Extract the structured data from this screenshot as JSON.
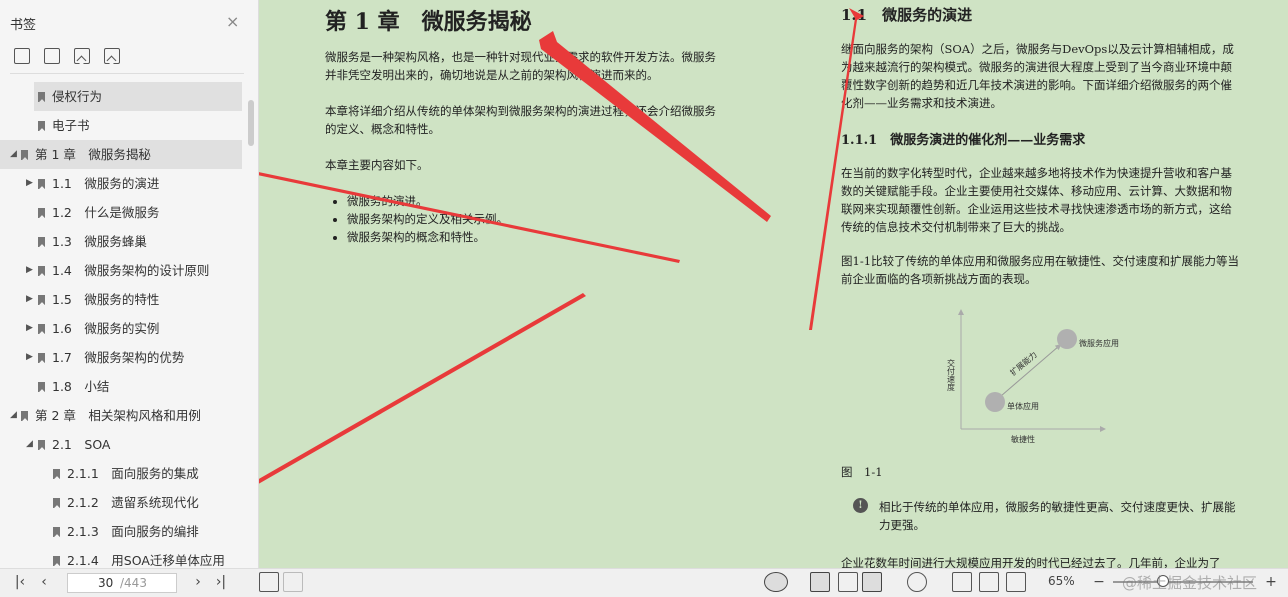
{
  "sidebar": {
    "title": "书签",
    "close": "×",
    "toc": [
      {
        "label": "侵权行为",
        "level": 1,
        "arrow": "",
        "selected": true
      },
      {
        "label": "电子书",
        "level": 1,
        "arrow": "",
        "selected": false
      },
      {
        "label": "第 1 章　微服务揭秘",
        "level": 0,
        "arrow": "◢",
        "selected": true
      },
      {
        "label": "1.1　微服务的演进",
        "level": 1,
        "arrow": "▶",
        "selected": false
      },
      {
        "label": "1.2　什么是微服务",
        "level": 1,
        "arrow": "",
        "selected": false
      },
      {
        "label": "1.3　微服务蜂巢",
        "level": 1,
        "arrow": "",
        "selected": false
      },
      {
        "label": "1.4　微服务架构的设计原则",
        "level": 1,
        "arrow": "▶",
        "selected": false
      },
      {
        "label": "1.5　微服务的特性",
        "level": 1,
        "arrow": "▶",
        "selected": false
      },
      {
        "label": "1.6　微服务的实例",
        "level": 1,
        "arrow": "▶",
        "selected": false
      },
      {
        "label": "1.7　微服务架构的优势",
        "level": 1,
        "arrow": "▶",
        "selected": false
      },
      {
        "label": "1.8　小结",
        "level": 1,
        "arrow": "",
        "selected": false
      },
      {
        "label": "第 2 章　相关架构风格和用例",
        "level": 0,
        "arrow": "◢",
        "selected": false
      },
      {
        "label": "2.1　SOA",
        "level": 1,
        "arrow": "◢",
        "selected": false
      },
      {
        "label": "2.1.1　面向服务的集成",
        "level": 2,
        "arrow": "",
        "selected": false
      },
      {
        "label": "2.1.2　遗留系统现代化",
        "level": 2,
        "arrow": "",
        "selected": false
      },
      {
        "label": "2.1.3　面向服务的编排",
        "level": 2,
        "arrow": "",
        "selected": false
      },
      {
        "label": "2.1.4　用SOA迁移单体应用",
        "level": 2,
        "arrow": "",
        "selected": false
      }
    ]
  },
  "doc": {
    "left_page": {
      "chapter_title": "第 1 章　微服务揭秘",
      "para1": "微服务是一种架构风格，也是一种针对现代业务需求的软件开发方法。微服务并非凭空发明出来的，确切地说是从之前的架构风格演进而来的。",
      "para2": "本章将详细介绍从传统的单体架构到微服务架构的演进过程，还会介绍微服务的定义、概念和特性。",
      "para3": "本章主要内容如下。",
      "bullets": [
        "微服务的演进。",
        "微服务架构的定义及相关示例。",
        "微服务架构的概念和特性。"
      ]
    },
    "right_page": {
      "section_title": "1.1　微服务的演进",
      "para1": "继面向服务的架构（SOA）之后，微服务与DevOps以及云计算相辅相成，成为越来越流行的架构模式。微服务的演进很大程度上受到了当今商业环境中颠覆性数字创新的趋势和近几年技术演进的影响。下面详细介绍微服务的两个催化剂——业务需求和技术演进。",
      "subsection_title": "1.1.1　微服务演进的催化剂——业务需求",
      "para2": "在当前的数字化转型时代，企业越来越多地将技术作为快速提升营收和客户基数的关键赋能手段。企业主要使用社交媒体、移动应用、云计算、大数据和物联网来实现颠覆性创新。企业运用这些技术寻找快速渗透市场的新方式，这给传统的信息技术交付机制带来了巨大的挑战。",
      "para3": "图1-1比较了传统的单体应用和微服务应用在敏捷性、交付速度和扩展能力等当前企业面临的各项新挑战方面的表现。",
      "figure": {
        "y_label": "交付速度",
        "x_label": "敏捷性",
        "arrow_label": "扩展能力",
        "point_high": "微服务应用",
        "point_low": "单体应用"
      },
      "figure_caption": "图　1-1",
      "note": "相比于传统的单体应用，微服务的敏捷性更高、交付速度更快、扩展能力更强。",
      "para4": "企业花数年时间进行大规模应用开发的时代已经过去了。几年前，企业为了"
    }
  },
  "bottom": {
    "current_page": "30",
    "total_pages": "/443",
    "zoom": "65%",
    "zoom_level": 0.36,
    "watermark": "@稀土掘金技术社区"
  },
  "colors": {
    "doc_bg": "#cfe3c4",
    "arrow": "#e83a3a"
  }
}
